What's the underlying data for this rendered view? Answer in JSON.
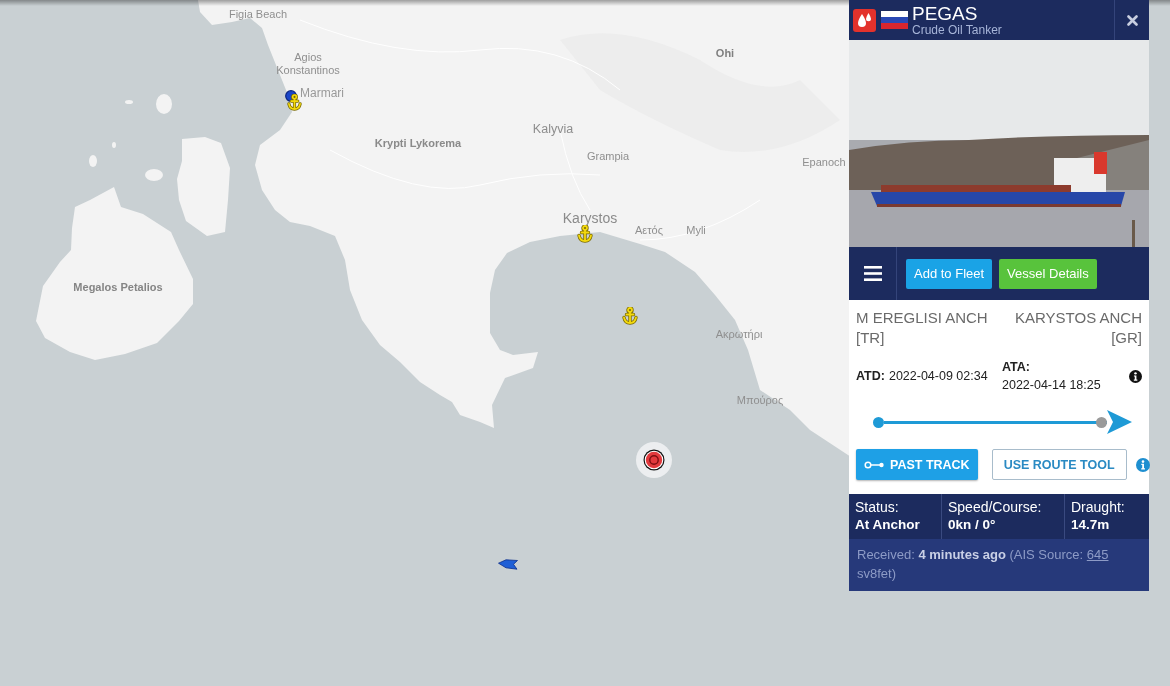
{
  "map": {
    "labels": [
      "Figia Beach",
      "Agios Konstantinos",
      "Marmari",
      "Krypti Lykorema",
      "Kalyvia",
      "Grampia",
      "Ohi",
      "Epanoch",
      "Karystos",
      "Αετός",
      "Myli",
      "Ακρωτήρι",
      "Μπούρος",
      "Megalos Petalios"
    ]
  },
  "vessel": {
    "name": "PEGAS",
    "type": "Crude Oil Tanker"
  },
  "actions": [
    {
      "label": "Add to Fleet",
      "kind": "primary"
    },
    {
      "label": "Vessel Details",
      "kind": "success"
    }
  ],
  "voyage": {
    "departure_port": "M EREGLISI ANCH [TR]",
    "arrival_port": "KARYSTOS ANCH [GR]",
    "departure": {
      "label": "ATD:",
      "value": "2022-04-09 02:34"
    },
    "arrival": {
      "label": "ATA:",
      "value": "2022-04-14 18:25"
    },
    "progress": {
      "level": 1
    }
  },
  "track_buttons": [
    {
      "label": "PAST TRACK",
      "kind": "filled"
    },
    {
      "label": "USE ROUTE TOOL",
      "kind": "outline"
    }
  ],
  "stats": [
    {
      "label": "Status:",
      "value": "At Anchor"
    },
    {
      "label": "Speed/Course:",
      "value": "0kn / 0°"
    },
    {
      "label": "Draught:",
      "value": "14.7m"
    }
  ],
  "received": {
    "text": "Received: **4 minutes ago** (AIS Source:",
    "link": "645",
    "suffix": "sv8fet)"
  }
}
